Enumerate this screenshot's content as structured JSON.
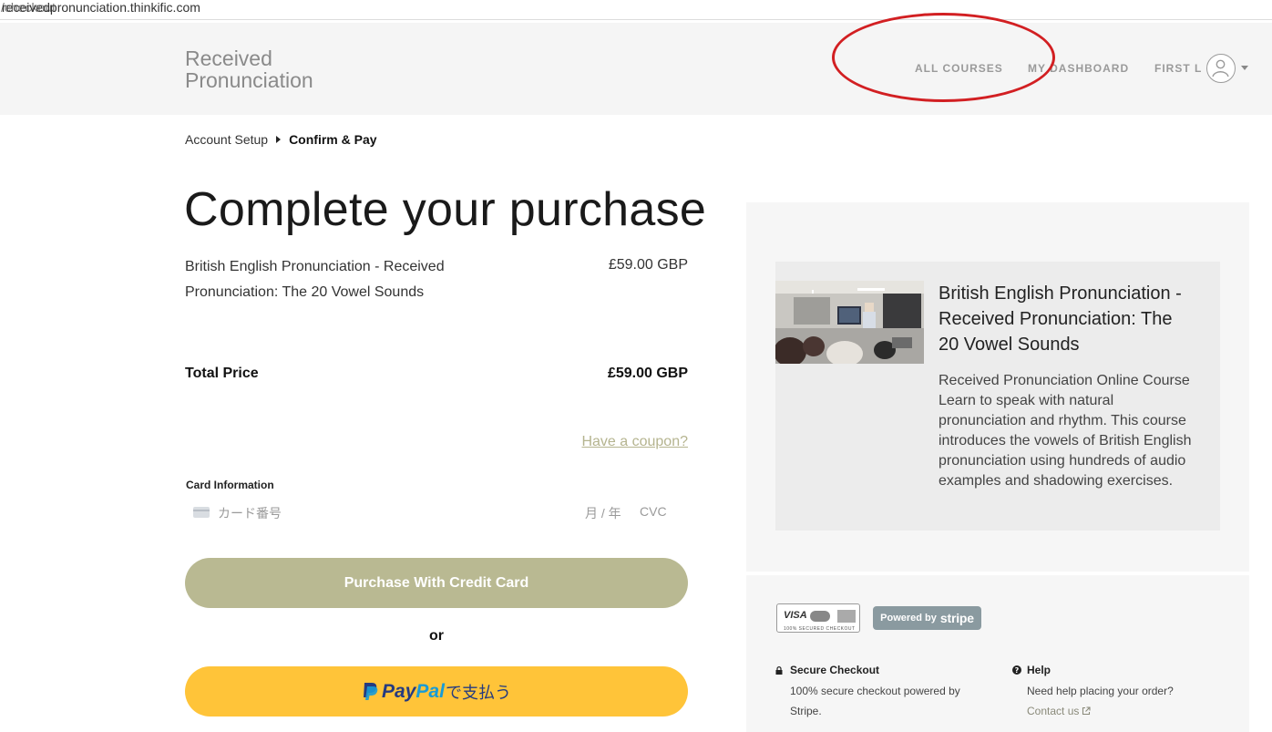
{
  "browser": {
    "url_host": "receivedpronunciation.thinkific.com",
    "url_path": "/checkout"
  },
  "header": {
    "brand_line1": "Received",
    "brand_line2": "Pronunciation",
    "nav_all_courses": "ALL COURSES",
    "nav_my_dashboard": "MY DASHBOARD",
    "nav_user": "FIRST L"
  },
  "breadcrumb": {
    "step1": "Account Setup",
    "step2": "Confirm & Pay"
  },
  "checkout": {
    "title": "Complete your purchase",
    "item_name": "British English Pronunciation - Received Pronunciation: The 20 Vowel Sounds",
    "item_price": "£59.00 GBP",
    "total_label": "Total Price",
    "total_value": "£59.00 GBP",
    "coupon_link": "Have a coupon?",
    "card_label": "Card Information",
    "card_number_placeholder": "カード番号",
    "card_expiry_placeholder": "月 / 年",
    "card_cvc_placeholder": "CVC",
    "credit_button": "Purchase With Credit Card",
    "or_text": "or",
    "paypal_pay": "Pay",
    "paypal_pal": "Pal",
    "paypal_suffix": "で支払う"
  },
  "course": {
    "title": "British English Pronunciation - Received Pronunciation: The 20 Vowel Sounds",
    "description": "Received Pronunciation Online Course Learn to speak with natural pronunciation and rhythm. This course introduces the vowels of British English pronunciation using hundreds of audio examples and shadowing exercises."
  },
  "footer": {
    "cards_visa": "VISA",
    "cards_caption": "100% SECURED CHECKOUT",
    "stripe_prefix": "Powered by",
    "stripe_brand": "stripe",
    "secure_title": "Secure Checkout",
    "secure_text": "100% secure checkout powered by Stripe.",
    "help_title": "Help",
    "help_text": "Need help placing your order?",
    "contact_link": "Contact us"
  },
  "colors": {
    "header_bg": "#f5f5f5",
    "credit_button": "#b9b992",
    "paypal_button": "#ffc439",
    "annotation": "#d21f22",
    "stripe_badge": "#8a9aa0"
  }
}
